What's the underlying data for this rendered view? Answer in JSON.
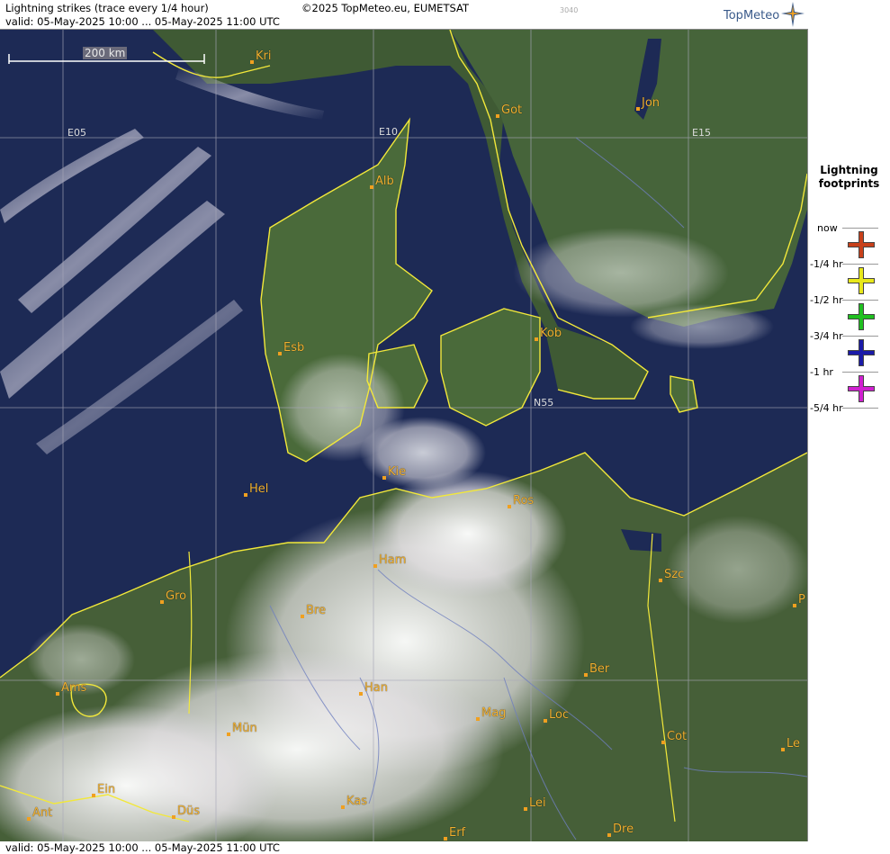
{
  "header": {
    "title": "Lightning strikes (trace every 1/4 hour)",
    "copyright": "©2025 TopMeteo.eu, EUMETSAT",
    "code": "3040",
    "valid": "valid:  05-May-2025 10:00 ... 05-May-2025 11:00 UTC",
    "logo": "TopMeteo"
  },
  "map": {
    "scale_label": "200 km",
    "grid_labels": [
      "E05",
      "E10",
      "E15",
      "N55"
    ],
    "cities": [
      {
        "name": "Kri"
      },
      {
        "name": "Got"
      },
      {
        "name": "Jon"
      },
      {
        "name": "Alb"
      },
      {
        "name": "Esb"
      },
      {
        "name": "Kob"
      },
      {
        "name": "Kie"
      },
      {
        "name": "Hel"
      },
      {
        "name": "Ros"
      },
      {
        "name": "Ham"
      },
      {
        "name": "Szc"
      },
      {
        "name": "Gro"
      },
      {
        "name": "Bre"
      },
      {
        "name": "P"
      },
      {
        "name": "Ber"
      },
      {
        "name": "Ams"
      },
      {
        "name": "Han"
      },
      {
        "name": "Mag"
      },
      {
        "name": "Loc"
      },
      {
        "name": "Mün"
      },
      {
        "name": "Cot"
      },
      {
        "name": "Le"
      },
      {
        "name": "Ein"
      },
      {
        "name": "Kas"
      },
      {
        "name": "Lei"
      },
      {
        "name": "Ant"
      },
      {
        "name": "Düs"
      },
      {
        "name": "Dre"
      },
      {
        "name": "Erf"
      }
    ]
  },
  "legend": {
    "title_line1": "Lightning",
    "title_line2": "footprints",
    "items": [
      {
        "label": "now",
        "color": "#c8401a"
      },
      {
        "label": "-1/4 hr",
        "color": "#e8e81a"
      },
      {
        "label": "-1/2 hr",
        "color": "#20c020"
      },
      {
        "label": "-3/4 hr",
        "color": "#1a1aa8"
      },
      {
        "label": "-1 hr",
        "color": "#d020d0"
      },
      {
        "label": "-5/4 hr",
        "color": ""
      }
    ]
  },
  "footer": {
    "valid": "valid:  05-May-2025 10:00 ... 05-May-2025 11:00 UTC"
  }
}
